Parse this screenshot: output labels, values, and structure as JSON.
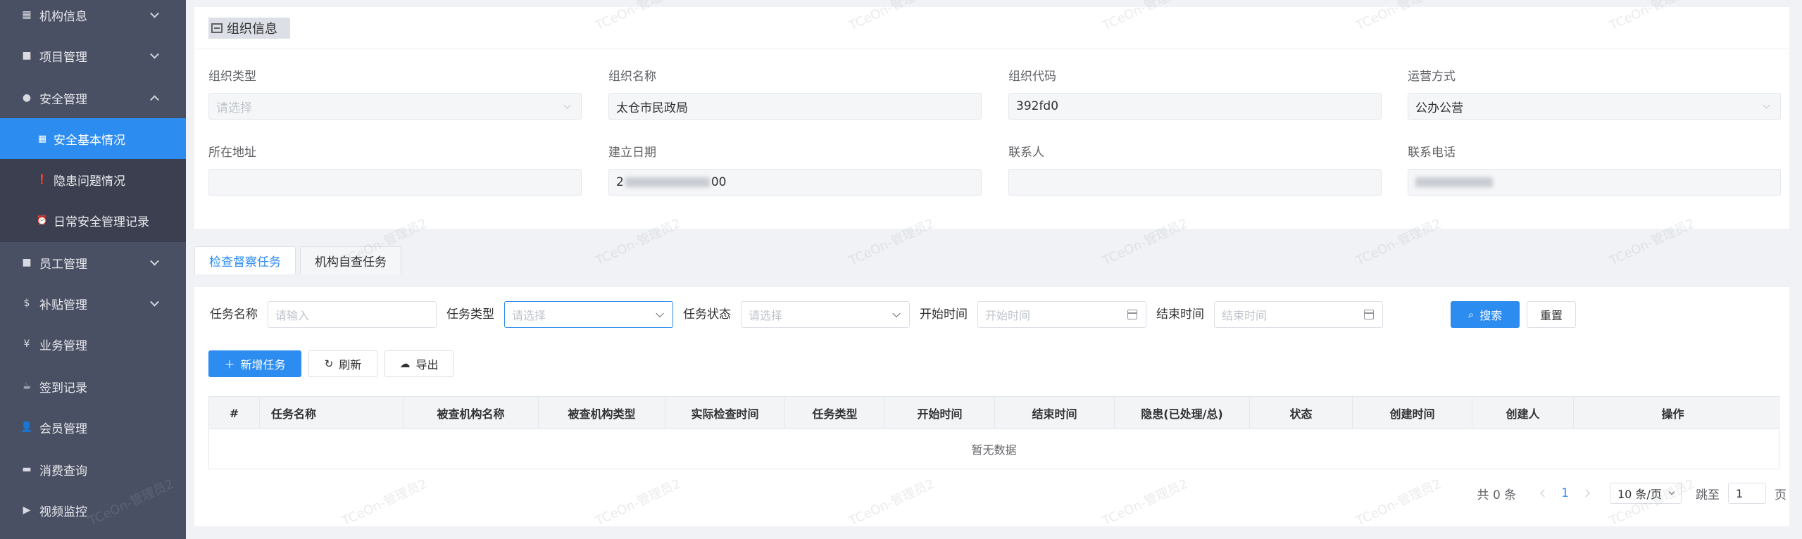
{
  "sidebar": {
    "items": [
      {
        "label": "机构信息",
        "icon": "grid-icon"
      },
      {
        "label": "项目管理",
        "icon": "folder-icon"
      },
      {
        "label": "安全管理",
        "icon": "location-pin-icon"
      },
      {
        "label": "员工管理",
        "icon": "folder-icon"
      },
      {
        "label": "补贴管理",
        "icon": "dollar-icon"
      },
      {
        "label": "业务管理",
        "icon": "yen-icon"
      },
      {
        "label": "签到记录",
        "icon": "cup-icon"
      },
      {
        "label": "会员管理",
        "icon": "user-icon"
      },
      {
        "label": "消费查询",
        "icon": "cart-icon"
      },
      {
        "label": "视频监控",
        "icon": "video-icon"
      }
    ],
    "submenu": [
      {
        "label": "安全基本情况",
        "icon": "grid-icon",
        "active": true
      },
      {
        "label": "隐患问题情况",
        "icon": "alert-circle-icon",
        "active": false
      },
      {
        "label": "日常安全管理记录",
        "icon": "alarm-clock-icon",
        "active": false
      }
    ]
  },
  "org": {
    "title": "组织信息",
    "fields": {
      "type": {
        "label": "组织类型",
        "value": "",
        "placeholder": "请选择"
      },
      "name": {
        "label": "组织名称",
        "value": "太仓市民政局"
      },
      "code": {
        "label": "组织代码",
        "value": "392fd0"
      },
      "mode": {
        "label": "运营方式",
        "value": "公办公营"
      },
      "address": {
        "label": "所在地址",
        "value": ""
      },
      "date": {
        "label": "建立日期",
        "value_prefix": "2",
        "value_suffix": "00"
      },
      "contact": {
        "label": "联系人",
        "value": ""
      },
      "phone": {
        "label": "联系电话",
        "value": ""
      }
    }
  },
  "tabs": [
    {
      "label": "检查督察任务",
      "active": true
    },
    {
      "label": "机构自查任务",
      "active": false
    }
  ],
  "filters": {
    "task_name": {
      "label": "任务名称",
      "placeholder": "请输入"
    },
    "task_type": {
      "label": "任务类型",
      "placeholder": "请选择"
    },
    "task_status": {
      "label": "任务状态",
      "placeholder": "请选择"
    },
    "start_time": {
      "label": "开始时间",
      "placeholder": "开始时间"
    },
    "end_time": {
      "label": "结束时间",
      "placeholder": "结束时间"
    },
    "search_label": "搜索",
    "reset_label": "重置"
  },
  "actions": {
    "add_label": "新增任务",
    "refresh_label": "刷新",
    "export_label": "导出"
  },
  "table": {
    "columns": [
      "#",
      "任务名称",
      "被查机构名称",
      "被查机构类型",
      "实际检查时间",
      "任务类型",
      "开始时间",
      "结束时间",
      "隐患(已处理/总)",
      "状态",
      "创建时间",
      "创建人",
      "操作"
    ],
    "empty_text": "暂无数据"
  },
  "pagination": {
    "total_text": "共 0 条",
    "current_page": "1",
    "page_size": "10 条/页",
    "jump_label": "跳至",
    "jump_value": "1",
    "page_suffix": "页"
  },
  "watermark": "TCeOn-管理员2",
  "colors": {
    "primary": "#2d8cf0",
    "sidebar": "#4a5064",
    "submenu": "#3b3f4f"
  }
}
